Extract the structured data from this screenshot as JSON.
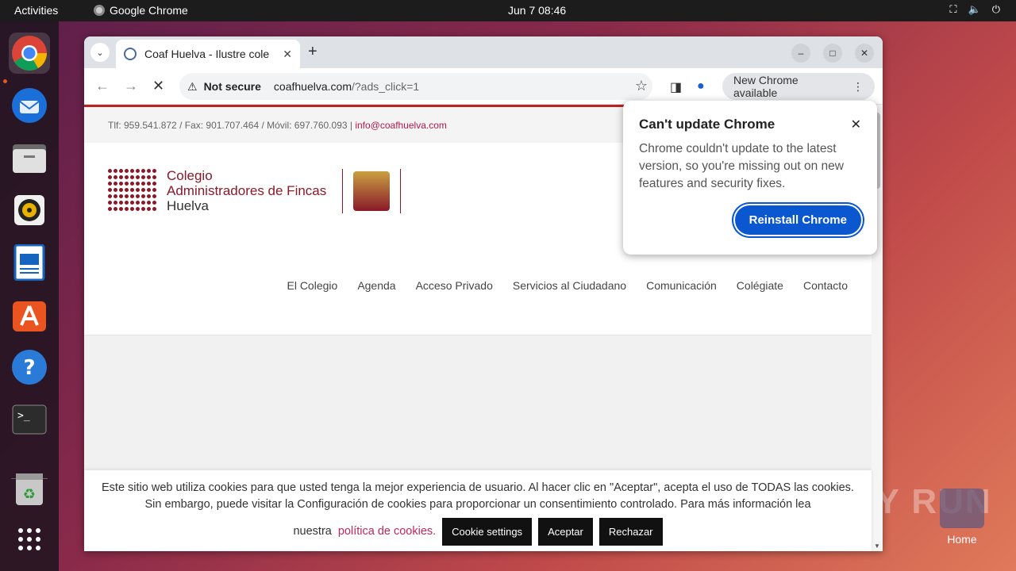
{
  "topbar": {
    "activities": "Activities",
    "app_name": "Google Chrome",
    "clock": "Jun 7  08:46"
  },
  "dock": {
    "items": [
      "chrome-icon",
      "thunderbird-icon",
      "files-icon",
      "rhythmbox-icon",
      "writer-icon",
      "app-center-icon",
      "help-icon",
      "terminal-icon",
      "trash-icon",
      "apps-grid-icon"
    ]
  },
  "desktop": {
    "home_label": "Home",
    "watermark": "ANY RUN"
  },
  "browser": {
    "tab_title": "Coaf Huelva - Ilustre cole",
    "omnibox": {
      "security": "Not secure",
      "domain": "coafhuelva.com",
      "path": "/?ads_click=1"
    },
    "new_chrome": "New Chrome available"
  },
  "page": {
    "contact": "Tlf: 959.541.872 / Fax: 901.707.464 / Móvil: 697.760.093  |  ",
    "email": "info@coafhuelva.com",
    "logo": {
      "line1": "Colegio",
      "line2": "Administradores de Fincas",
      "line3": "Huelva"
    },
    "nav": [
      "El Colegio",
      "Agenda",
      "Acceso Privado",
      "Servicios al Ciudadano",
      "Comunicación",
      "Colégiate",
      "Contacto"
    ]
  },
  "cookie": {
    "text1": "Este sitio web utiliza cookies para que usted tenga la mejor experiencia de usuario. Al hacer clic en \"Aceptar\", acepta el uso de TODAS las cookies. Sin embargo, puede visitar la Configuración de cookies para proporcionar un consentimiento controlado. Para más información lea",
    "text2": "nuestra",
    "link": "política de cookies.",
    "settings": "Cookie settings",
    "accept": "Aceptar",
    "reject": "Rechazar"
  },
  "popup": {
    "title": "Can't update Chrome",
    "body": "Chrome couldn't update to the latest version, so you're missing out on new features and security fixes.",
    "button": "Reinstall Chrome"
  }
}
